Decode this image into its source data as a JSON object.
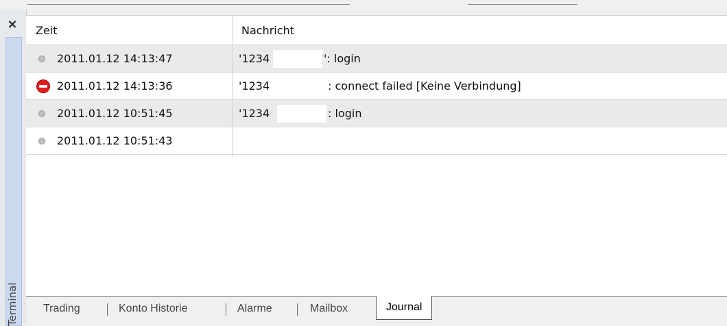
{
  "sidebar": {
    "label": "Terminal",
    "close_glyph": "×"
  },
  "columns": {
    "zeit": "Zeit",
    "nachricht": "Nachricht"
  },
  "rows": [
    {
      "icon": "info-dot-icon",
      "time": "2011.01.12 14:13:47",
      "msg_prefix": "'1234",
      "msg_suffix": "': login"
    },
    {
      "icon": "error-icon",
      "time": "2011.01.12 14:13:36",
      "msg_prefix": "'1234",
      "msg_suffix": ": connect failed [Keine Verbindung]"
    },
    {
      "icon": "info-dot-icon",
      "time": "2011.01.12 10:51:45",
      "msg_prefix": "'1234",
      "msg_suffix": ": login"
    },
    {
      "icon": "info-dot-icon",
      "time": "2011.01.12 10:51:43",
      "msg_prefix": "",
      "msg_suffix": ""
    }
  ],
  "tabs": [
    {
      "label": "Trading"
    },
    {
      "label": "Konto Historie"
    },
    {
      "label": "Alarme"
    },
    {
      "label": "Mailbox"
    },
    {
      "label": "Journal",
      "active": true
    }
  ],
  "colors": {
    "error": "#e41c1c",
    "alt_row": "#eaeaea",
    "sidebar_strip": "#c9d9ee"
  }
}
